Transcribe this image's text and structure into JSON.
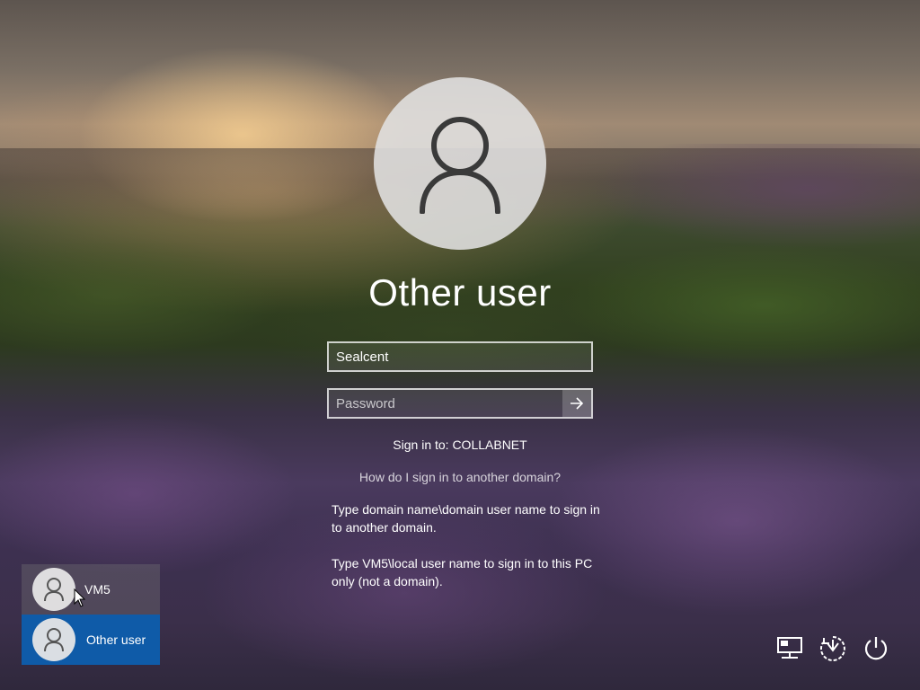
{
  "login": {
    "user_name": "Other user",
    "username_value": "Sealcent",
    "password_placeholder": "Password",
    "sign_in_to": "Sign in to: COLLABNET",
    "help_link": "How do I sign in to another domain?",
    "help_text_1": "Type domain name\\domain user name to sign in to another domain.",
    "help_text_2": "Type VM5\\local user name to sign in to this PC only (not a domain)."
  },
  "user_list": [
    {
      "label": "VM5",
      "selected": false
    },
    {
      "label": "Other user",
      "selected": true
    }
  ],
  "tray": {
    "icons": [
      "network-icon",
      "ease-of-access-icon",
      "power-icon"
    ]
  },
  "colors": {
    "selected_tile": "#0f5ba8",
    "text": "#ffffff"
  }
}
